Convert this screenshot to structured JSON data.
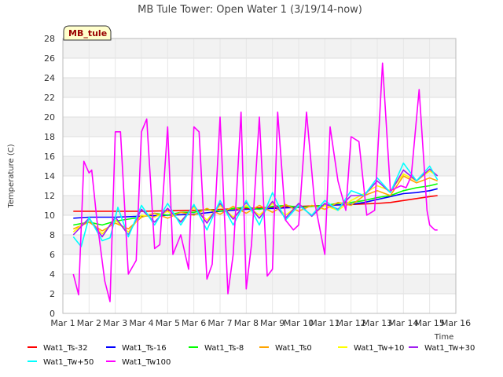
{
  "chart_data": {
    "type": "line",
    "title": "MB Tule Tower: Open Water 1 (3/19/14-now)",
    "xlabel": "Time",
    "ylabel": "Temperature (C)",
    "site_tag": "MB_tule",
    "xlim": [
      1,
      16
    ],
    "ylim": [
      0,
      28
    ],
    "x_ticks": [
      1,
      2,
      3,
      4,
      5,
      6,
      7,
      8,
      9,
      10,
      11,
      12,
      13,
      14,
      15,
      16
    ],
    "x_tick_labels": [
      "Mar 1",
      "Mar 2",
      "Mar 3",
      "Mar 4",
      "Mar 5",
      "Mar 6",
      "Mar 7",
      "Mar 8",
      "Mar 9",
      "Mar 10",
      "Mar 11",
      "Mar 12",
      "Mar 13",
      "Mar 14",
      "Mar 15",
      "Mar 16"
    ],
    "y_ticks": [
      0,
      2,
      4,
      6,
      8,
      10,
      12,
      14,
      16,
      18,
      20,
      22,
      24,
      26,
      28
    ],
    "x_unit": "day of March",
    "series": [
      {
        "name": "Wat1_Ts-32",
        "color": "#ff0000",
        "x": [
          1.4,
          2.5,
          4,
          6,
          8,
          10,
          11,
          12,
          13,
          13.5,
          14,
          14.5,
          15,
          15.3
        ],
        "y": [
          10.4,
          10.4,
          10.4,
          10.5,
          10.7,
          10.9,
          11.0,
          11.1,
          11.2,
          11.3,
          11.5,
          11.7,
          11.9,
          12.0
        ]
      },
      {
        "name": "Wat1_Ts-16",
        "color": "#0000ff",
        "x": [
          1.4,
          2,
          3,
          4,
          5,
          6,
          7,
          8,
          9,
          10,
          11,
          12,
          12.5,
          13,
          13.5,
          14,
          14.5,
          15,
          15.3
        ],
        "y": [
          9.7,
          9.8,
          9.8,
          9.9,
          10.0,
          10.1,
          10.4,
          10.6,
          10.7,
          10.8,
          11.0,
          11.1,
          11.3,
          11.6,
          11.9,
          12.2,
          12.3,
          12.5,
          12.7
        ]
      },
      {
        "name": "Wat1_Ts-8",
        "color": "#00ff00",
        "x": [
          1.4,
          2,
          2.5,
          3,
          3.5,
          4,
          4.5,
          5,
          5.5,
          6,
          6.5,
          7,
          7.5,
          8,
          8.5,
          9,
          9.5,
          10,
          10.5,
          11,
          11.5,
          12,
          12.5,
          13,
          13.5,
          14,
          14.5,
          15,
          15.3
        ],
        "y": [
          9.0,
          9.3,
          9.0,
          9.4,
          9.6,
          9.8,
          10.2,
          10.0,
          10.3,
          10.3,
          10.6,
          10.4,
          10.7,
          10.8,
          10.6,
          10.9,
          11.0,
          10.8,
          10.9,
          11.0,
          11.2,
          11.3,
          11.5,
          11.8,
          12.0,
          12.5,
          12.8,
          13.0,
          13.2
        ]
      },
      {
        "name": "Wat1_Ts0",
        "color": "#ffa500",
        "x": [
          1.4,
          2,
          2.5,
          3,
          3.5,
          4,
          4.5,
          5,
          5.5,
          6,
          6.5,
          7,
          7.5,
          8,
          8.5,
          9,
          9.5,
          10,
          10.5,
          11,
          11.5,
          12,
          12.5,
          13,
          13.5,
          14,
          14.5,
          15,
          15.3
        ],
        "y": [
          8.6,
          9.3,
          8.4,
          9.2,
          8.6,
          9.8,
          10.2,
          9.7,
          10.3,
          10.0,
          10.7,
          10.1,
          10.9,
          10.2,
          11.0,
          10.3,
          11.1,
          10.4,
          11.0,
          10.6,
          11.3,
          11.0,
          12.0,
          12.5,
          12.0,
          14.0,
          13.3,
          13.8,
          13.5
        ]
      },
      {
        "name": "Wat1_Tw+10",
        "color": "#ffff00",
        "x": [
          1.4,
          2,
          2.5,
          3,
          3.5,
          4,
          4.5,
          5,
          5.5,
          6,
          6.5,
          7,
          7.5,
          8,
          8.5,
          9,
          9.5,
          10,
          10.5,
          11,
          11.5,
          12,
          12.5,
          13,
          13.5,
          14,
          14.5,
          15,
          15.3
        ],
        "y": [
          8.3,
          9.6,
          8.1,
          9.5,
          8.3,
          10.0,
          9.8,
          10.4,
          9.4,
          10.8,
          9.5,
          11.0,
          9.8,
          11.0,
          10.0,
          11.2,
          10.0,
          11.0,
          10.0,
          11.0,
          10.5,
          11.5,
          12.2,
          13.0,
          12.5,
          14.2,
          13.5,
          14.5,
          14.0
        ]
      },
      {
        "name": "Wat1_Tw+30",
        "color": "#a020f0",
        "x": [
          1.4,
          2,
          2.5,
          3,
          3.5,
          4,
          4.5,
          5,
          5.5,
          6,
          6.5,
          7,
          7.5,
          8,
          8.5,
          9,
          9.5,
          10,
          10.5,
          11,
          11.5,
          12,
          12.5,
          13,
          13.5,
          14,
          14.5,
          15,
          15.3
        ],
        "y": [
          8.0,
          9.7,
          7.8,
          9.8,
          8.0,
          10.6,
          9.3,
          10.7,
          9.3,
          11.0,
          9.2,
          11.2,
          9.6,
          11.3,
          9.7,
          11.4,
          9.7,
          11.2,
          9.9,
          11.2,
          10.6,
          12.0,
          12.0,
          13.5,
          12.3,
          14.6,
          13.5,
          14.7,
          14.0
        ]
      },
      {
        "name": "Wat1_Tw+50",
        "color": "#00ffff",
        "x": [
          1.4,
          1.7,
          2,
          2.5,
          2.8,
          3.1,
          3.5,
          4,
          4.5,
          5,
          5.5,
          6,
          6.5,
          7,
          7.5,
          8,
          8.5,
          9,
          9.5,
          10,
          10.5,
          11,
          11.5,
          12,
          12.5,
          13,
          13.5,
          14,
          14.5,
          15,
          15.3
        ],
        "y": [
          7.8,
          6.8,
          9.8,
          7.4,
          7.7,
          10.8,
          7.8,
          11.0,
          9.0,
          11.2,
          9.0,
          11.1,
          8.5,
          11.5,
          9.0,
          11.5,
          9.0,
          12.3,
          9.5,
          11.0,
          10.0,
          11.5,
          10.5,
          12.5,
          12.0,
          13.8,
          12.3,
          15.3,
          13.5,
          15.0,
          13.6
        ]
      },
      {
        "name": "Wat1_Tw100",
        "color": "#ff00ff",
        "x": [
          1.4,
          1.6,
          1.8,
          2.0,
          2.1,
          2.3,
          2.6,
          2.8,
          3.0,
          3.2,
          3.5,
          3.8,
          4.0,
          4.2,
          4.5,
          4.7,
          5.0,
          5.2,
          5.5,
          5.8,
          6.0,
          6.2,
          6.5,
          6.7,
          7.0,
          7.3,
          7.5,
          7.8,
          8.0,
          8.2,
          8.5,
          8.8,
          9.0,
          9.2,
          9.5,
          9.8,
          10.0,
          10.3,
          10.6,
          11.0,
          11.2,
          11.5,
          11.8,
          12.0,
          12.3,
          12.6,
          12.9,
          13.2,
          13.5,
          13.9,
          14.1,
          14.3,
          14.6,
          14.9,
          15.0,
          15.2,
          15.3
        ],
        "y": [
          4.0,
          1.9,
          15.5,
          14.3,
          14.6,
          9.5,
          3.3,
          1.2,
          18.5,
          18.5,
          4.0,
          5.4,
          18.5,
          19.8,
          6.6,
          7.0,
          19.0,
          6.0,
          8.0,
          4.5,
          19.0,
          18.5,
          3.5,
          5.0,
          20.0,
          2.0,
          6.0,
          20.5,
          2.5,
          7.0,
          20.0,
          3.8,
          4.5,
          20.5,
          9.5,
          8.5,
          9.0,
          20.5,
          11.5,
          6.0,
          19.0,
          13.5,
          10.5,
          18.0,
          17.5,
          10.0,
          10.5,
          25.5,
          12.5,
          13.0,
          12.8,
          14.0,
          22.8,
          10.5,
          9.0,
          8.5,
          8.5
        ]
      }
    ],
    "legend_position": "bottom",
    "grid": true
  }
}
